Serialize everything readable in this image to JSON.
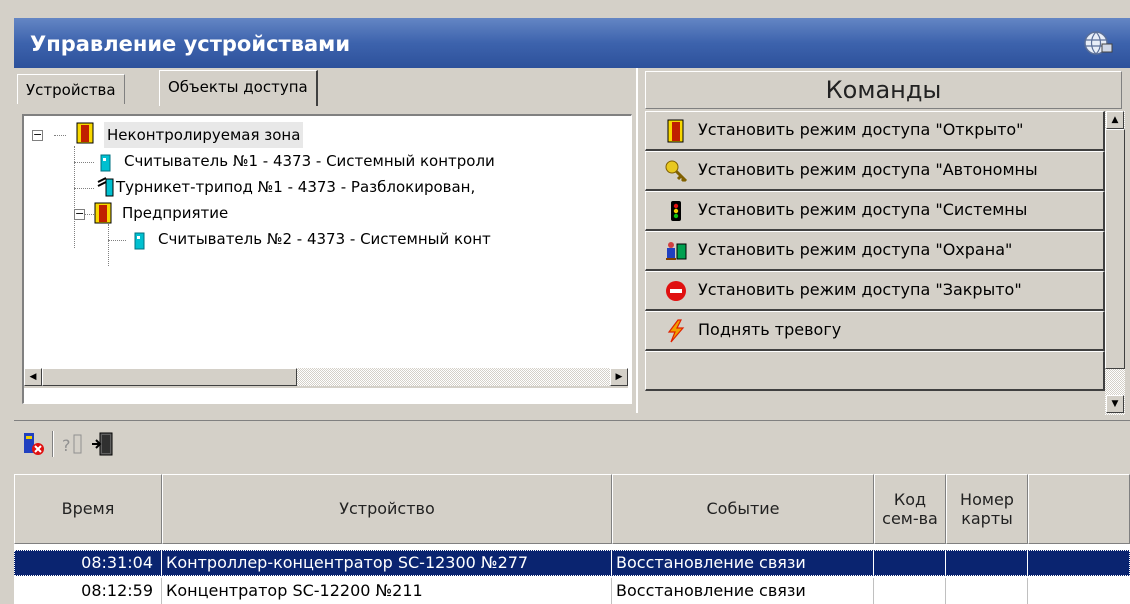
{
  "window": {
    "title": "Управление устройствами"
  },
  "tabs": [
    {
      "label": "Устройства",
      "active": false
    },
    {
      "label": "Объекты доступа",
      "active": true
    }
  ],
  "tree": [
    {
      "label": "Неконтролируемая зона",
      "icon": "door-icon",
      "expander": "−"
    },
    {
      "label": "Считыватель №1 - 4373 - Системный контроли",
      "icon": "reader-icon"
    },
    {
      "label": "Турникет-трипод №1 - 4373 - Разблокирован,",
      "icon": "turnstile-icon"
    },
    {
      "label": "Предприятие",
      "icon": "door-icon",
      "expander": "−"
    },
    {
      "label": "Считыватель №2 - 4373 - Системный конт",
      "icon": "reader-icon"
    }
  ],
  "commands": {
    "header": "Команды",
    "items": [
      {
        "label": "Установить режим доступа \"Открыто\"",
        "icon": "door-open-icon"
      },
      {
        "label": "Установить режим доступа \"Автономны",
        "icon": "key-icon"
      },
      {
        "label": "Установить режим доступа \"Системны",
        "icon": "traffic-light-icon"
      },
      {
        "label": "Установить режим доступа \"Охрана\"",
        "icon": "guard-icon"
      },
      {
        "label": "Установить режим доступа \"Закрыто\"",
        "icon": "no-entry-icon"
      },
      {
        "label": "Поднять тревогу",
        "icon": "lightning-icon"
      }
    ]
  },
  "toolbar": {
    "icons": [
      "clear-events-icon",
      "help-icon",
      "exit-door-icon"
    ]
  },
  "events": {
    "columns": [
      "Время",
      "Устройство",
      "Событие",
      "Код сем-ва",
      "Номер карты"
    ],
    "rows": [
      {
        "time": "08:31:04",
        "device": "Контроллер-концентратор SC-12300 №277",
        "event": "Восстановление связи",
        "family": "",
        "card": "",
        "selected": true
      },
      {
        "time": "08:12:59",
        "device": "Концентратор SC-12200 №211",
        "event": "Восстановление связи",
        "family": "",
        "card": "",
        "selected": false
      }
    ]
  },
  "colors": {
    "title_bar": "#3d63ad",
    "selection": "#0a2470",
    "door_yellow": "#f8d800",
    "reader_cyan": "#00c0d0"
  }
}
